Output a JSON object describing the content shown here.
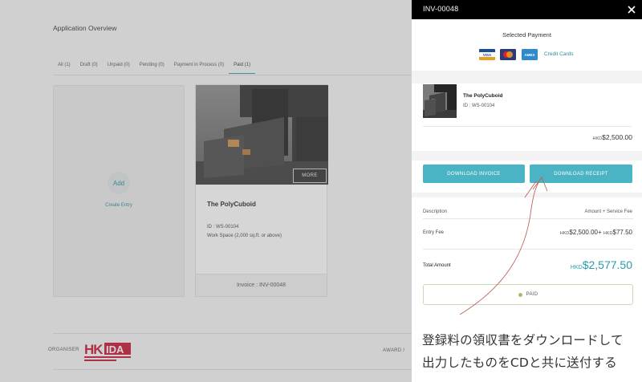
{
  "app": {
    "title": "Application Overview"
  },
  "tabs": [
    {
      "label": "All (1)",
      "active": false
    },
    {
      "label": "Draft (0)",
      "active": false
    },
    {
      "label": "Unpaid (0)",
      "active": false
    },
    {
      "label": "Pending (0)",
      "active": false
    },
    {
      "label": "Payment in Process (0)",
      "active": false
    },
    {
      "label": "Paid (1)",
      "active": true
    }
  ],
  "add_card": {
    "circle_label": "Add",
    "link_label": "Create Entry"
  },
  "entry_card": {
    "more_label": "MORE",
    "name": "The PolyCuboid",
    "id_line": "ID : WS-00104",
    "category": "Work Space (2,000 sq.ft. or above)",
    "invoice_line": "Invoice : INV-00048"
  },
  "footer": {
    "organiser_label": "ORGANISER",
    "award_label": "AWARD /"
  },
  "panel": {
    "title": "INV-00048",
    "selected_payment_label": "Selected Payment",
    "card_icons": [
      {
        "icon": "visa-card-icon",
        "text": "VISA"
      },
      {
        "icon": "mastercard-icon",
        "text": ""
      },
      {
        "icon": "amex-card-icon",
        "text": "AMEX"
      }
    ],
    "credit_cards_label": "Credit Cards",
    "item": {
      "name": "The PolyCuboid",
      "id_line": "ID : WS-00104",
      "currency": "HKD",
      "price": "$2,500.00"
    },
    "download_invoice_label": "DOWNLOAD INVOICE",
    "download_receipt_label": "DOWNLOAD RECEIPT",
    "table": {
      "description_header": "Description",
      "fee_header": "Amount + Service Fee",
      "entry_fee_label": "Entry Fee",
      "entry_fee_currency": "HKD",
      "entry_fee_amount": "$2,500.00+",
      "service_fee_currency": "HKD",
      "service_fee_amount": "$77.50",
      "total_label": "Total Amount",
      "total_currency": "HKD",
      "total_amount": "$2,577.50"
    },
    "status_label": "PAID"
  },
  "annotation": {
    "line1": "登録料の領収書をダウンロードして",
    "line2": "出力したものをCDと共に送付する"
  },
  "colors": {
    "accent": "#4ab4c4",
    "teal_text": "#2a9aa8",
    "annotation_arrow": "#c0605a"
  }
}
